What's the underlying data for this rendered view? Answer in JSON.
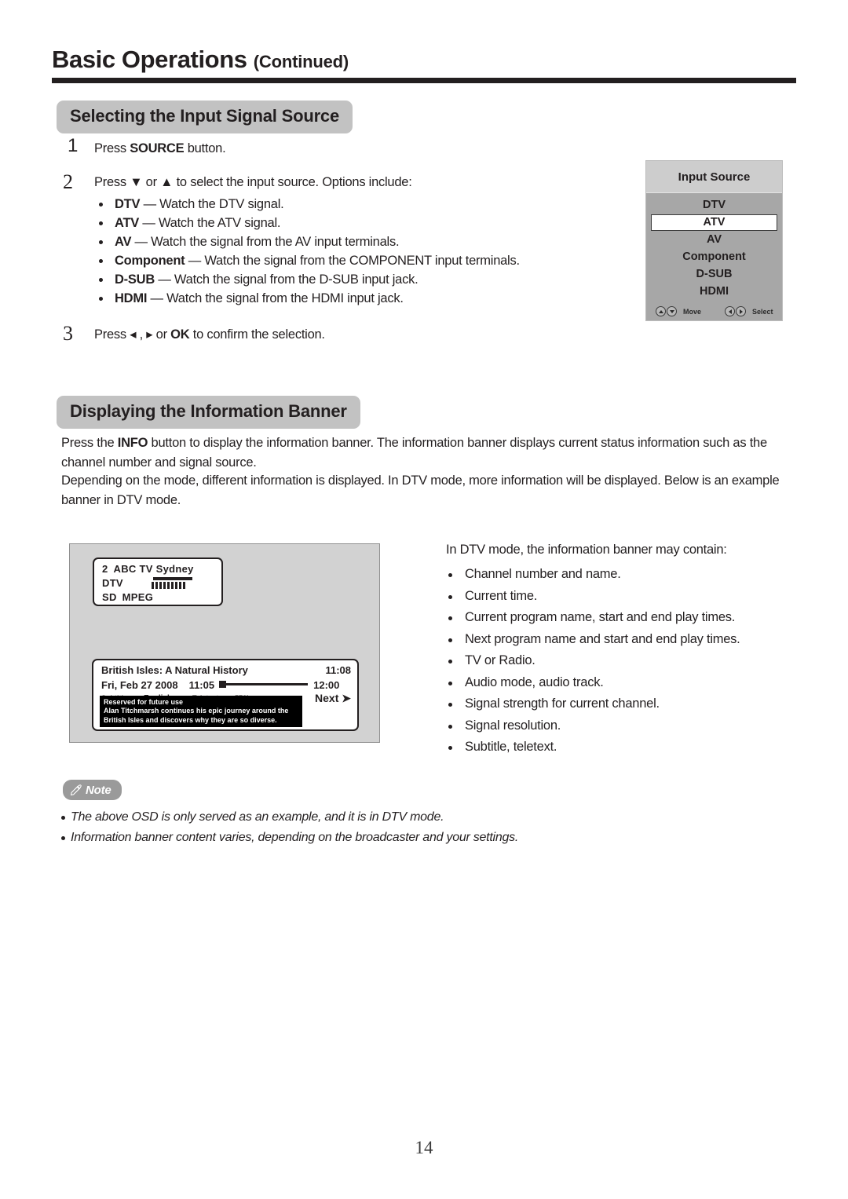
{
  "header": {
    "title": "Basic Operations",
    "title_suffix": "(Continued)"
  },
  "sections": {
    "input_source": {
      "heading": "Selecting the Input Signal Source",
      "steps": [
        {
          "number": "1",
          "text_before": "Press ",
          "strong": "SOURCE",
          "text_after": " button."
        },
        {
          "number": "2",
          "text": "Press ▼ or ▲ to select the input source. Options include:"
        },
        {
          "number": "3",
          "text_before": "Press ◂ , ▸ or ",
          "strong": "OK",
          "text_after": " to confirm the selection."
        }
      ],
      "options": [
        {
          "term": "DTV",
          "desc": "— Watch the DTV signal."
        },
        {
          "term": "ATV",
          "desc": "— Watch the ATV signal."
        },
        {
          "term": "AV",
          "desc": "— Watch the signal from the AV input terminals."
        },
        {
          "term": "Component",
          "desc": "— Watch the signal from the COMPONENT input terminals."
        },
        {
          "term": "D-SUB",
          "desc": "— Watch the signal from the D-SUB input jack."
        },
        {
          "term": "HDMI",
          "desc": "— Watch the signal from the HDMI input jack."
        }
      ]
    },
    "info_banner": {
      "heading": "Displaying the Information Banner",
      "paragraph1_before": "Press the ",
      "paragraph1_strong": "INFO",
      "paragraph1_after": " button to display the information banner. The information banner displays current status information such as the channel number and signal source.",
      "paragraph2": "Depending on the mode, different information is displayed. In DTV mode, more information will be displayed. Below is an example banner in DTV mode.",
      "dtv_intro": "In DTV mode, the information banner may contain:",
      "dtv_items": [
        "Channel number and name.",
        "Current time.",
        "Current program name, start and end play times.",
        "Next program name and start and end play times.",
        "TV or Radio.",
        "Audio mode, audio track.",
        "Signal strength for current channel.",
        "Signal resolution.",
        "Subtitle, teletext."
      ]
    }
  },
  "osd": {
    "title": "Input Source",
    "items": [
      "DTV",
      "ATV",
      "AV",
      "Component",
      "D-SUB",
      "HDMI"
    ],
    "selected": "ATV",
    "footer": {
      "move_label": "Move",
      "select_label": "Select"
    },
    "colors": {
      "body_bg": "#a7a7a7",
      "header_bg": "#cdcdcd",
      "selected_bg": "#ffffff"
    }
  },
  "tv_banner": {
    "top": {
      "channel_number": "2",
      "channel_name": "ABC TV Sydney",
      "mode": "DTV",
      "resolution": "SD",
      "codec": "MPEG",
      "signal_bars": 9
    },
    "bottom": {
      "program_title": "British Isles: A Natural History",
      "current_time": "11:08",
      "date": "Fri, Feb 27 2008",
      "start_time": "11:05",
      "end_time": "12:00",
      "next_label": "Next ➤",
      "subtitle_label": "Subtitle",
      "subtitle_value": "English",
      "teletext_label": "Teletext",
      "resolution_value": "576i",
      "description_lines": [
        "Reserved for future use",
        "Alan Titchmarsh continues his epic journey around the",
        "British Isles and discovers why they are so diverse."
      ]
    }
  },
  "note": {
    "label": "Note",
    "items": [
      "The above OSD is only served as an example, and it is in DTV mode.",
      "Information banner content varies, depending on the broadcaster and your settings."
    ]
  },
  "footer": {
    "page_number": "14"
  }
}
